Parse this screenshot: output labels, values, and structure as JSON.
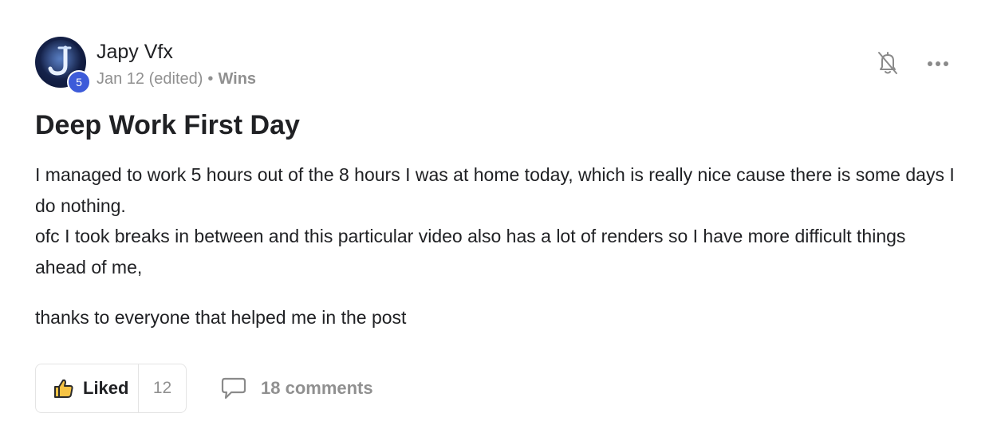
{
  "post": {
    "author": {
      "name": "Japy Vfx",
      "level": "5",
      "avatar_letter": "J"
    },
    "meta": {
      "date": "Jan 12 (edited)",
      "separator": "•",
      "category": "Wins"
    },
    "title": "Deep Work First Day",
    "body": [
      "I managed to work 5 hours out of the 8 hours I was at home today, which is really nice cause there is some days I do nothing.",
      "ofc I took breaks in between and this particular video also has a lot of renders so I have more difficult things ahead of me,",
      "thanks to everyone that helped me in the post"
    ],
    "actions": {
      "like_label": "Liked",
      "like_count": "12",
      "comments_label": "18 comments"
    },
    "icons": {
      "notifications": "bell-off-icon",
      "more": "more-horizontal-icon",
      "like": "thumbs-up-icon",
      "comments": "comment-bubble-icon"
    },
    "colors": {
      "level_badge": "#3d5bd9",
      "thumb_fill": "#f6c344",
      "muted_text": "#909090",
      "primary_text": "#202124"
    }
  }
}
